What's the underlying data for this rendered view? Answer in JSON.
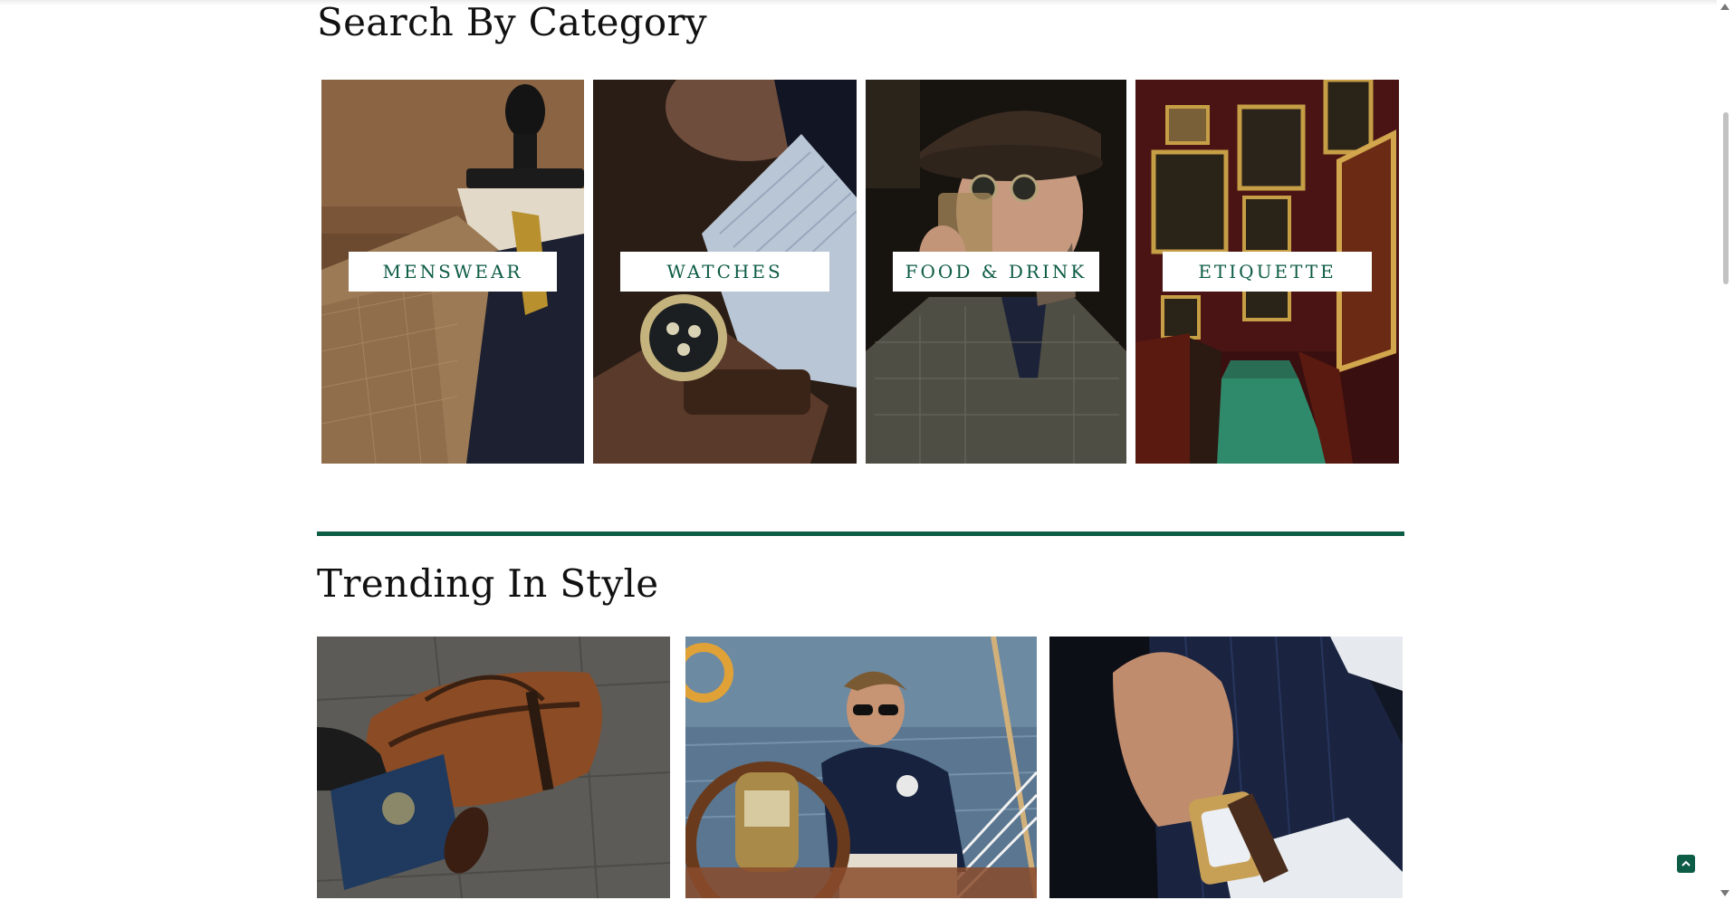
{
  "colors": {
    "accent": "#0d5c45",
    "background": "#ffffff",
    "title_text": "#111111"
  },
  "category_section": {
    "title": "Search By Category",
    "categories": [
      {
        "label": "MENSWEAR",
        "image": "Mannequin in brown plaid blazer with navy sweater and tie"
      },
      {
        "label": "WATCHES",
        "image": "Wrist with striped shirt cuff and chronograph watch"
      },
      {
        "label": "FOOD & DRINK",
        "image": "Man in flat cap and sunglasses drinking from a glass"
      },
      {
        "label": "ETIQUETTE",
        "image": "Red-walled club hallway with framed portraits and green carpet"
      }
    ]
  },
  "trending_section": {
    "title": "Trending In Style",
    "articles": [
      {
        "image": "Hand holding passport beside brown leather duffel bag"
      },
      {
        "image": "Man in sunglasses and navy jacket at the helm of a sailboat"
      },
      {
        "image": "Hand adjusting navy pinstripe sleeve wearing gold watch"
      }
    ]
  },
  "icons": {
    "back_to_top": "chevron-up-icon",
    "scroll_up": "scroll-up-arrow-icon",
    "scroll_down": "scroll-down-arrow-icon"
  }
}
